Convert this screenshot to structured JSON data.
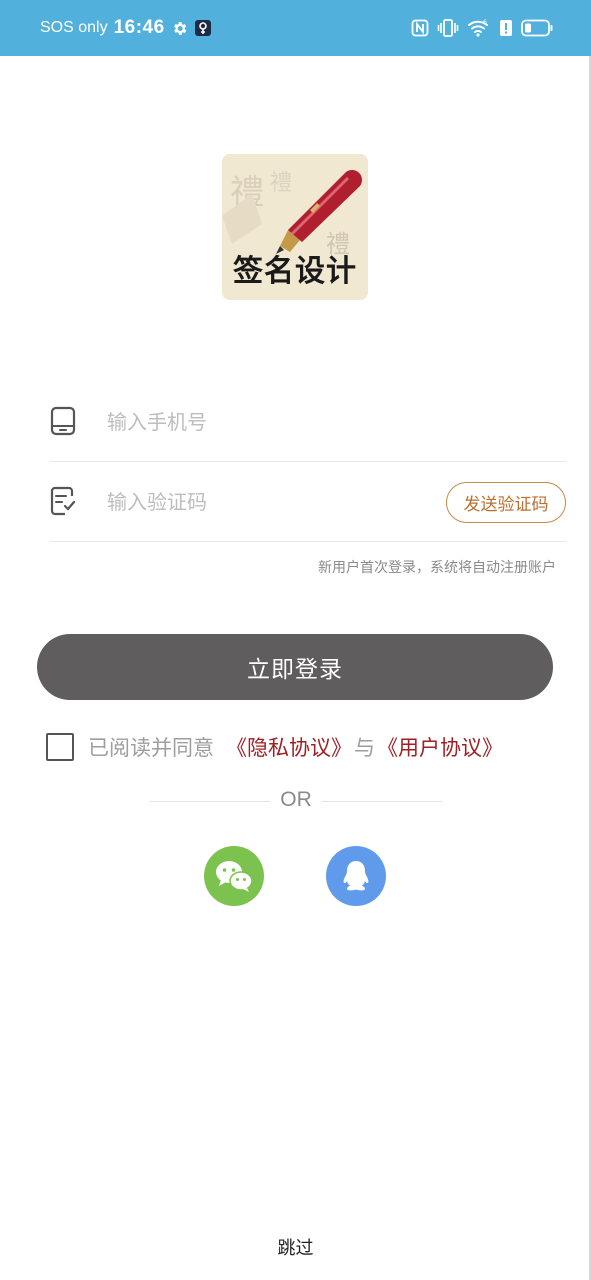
{
  "status_bar": {
    "carrier": "SOS only",
    "time": "16:46",
    "background": "#52b1dc",
    "left_icons": [
      "settings-icon",
      "vpn-key-icon"
    ],
    "right_icons": [
      "nfc-icon",
      "vibrate-icon",
      "wifi-icon",
      "alert-icon",
      "battery-icon"
    ]
  },
  "app": {
    "logo_text": "签名设计"
  },
  "form": {
    "phone_placeholder": "输入手机号",
    "code_placeholder": "输入验证码",
    "send_code_label": "发送验证码",
    "hint": "新用户首次登录，系统将自动注册账户"
  },
  "login_button": "立即登录",
  "agreement": {
    "checked": false,
    "prefix": "已阅读并同意",
    "privacy_link": "《隐私协议》",
    "and": "与",
    "user_link": "《用户协议》",
    "link_color": "#a11e23"
  },
  "divider_label": "OR",
  "social": [
    {
      "name": "wechat",
      "icon": "wechat-icon",
      "color": "#7cc24e"
    },
    {
      "name": "qq",
      "icon": "qq-icon",
      "color": "#5f9bea"
    }
  ],
  "skip_label": "跳过"
}
